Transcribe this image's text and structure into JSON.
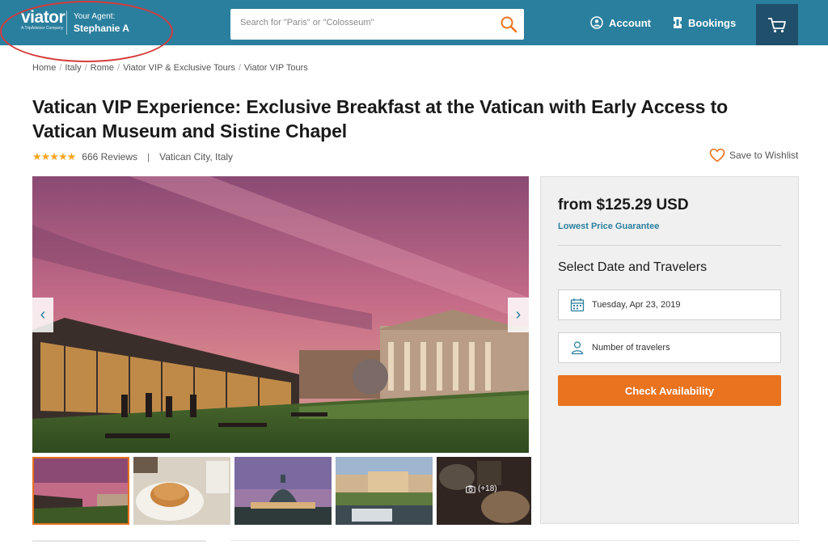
{
  "header": {
    "logo": {
      "word": "viator",
      "sub": "A TripAdvisor Company"
    },
    "agent": {
      "label": "Your Agent:",
      "name": "Stephanie A"
    },
    "search": {
      "placeholder": "Search for \"Paris\" or \"Colosseum\"",
      "value": ""
    },
    "nav": {
      "account": "Account",
      "bookings": "Bookings"
    },
    "colors": {
      "bar": "#2a7f9e",
      "cart_bg": "#1f4f6b",
      "annotation": "#d63a3a"
    }
  },
  "breadcrumb": [
    "Home",
    "Italy",
    "Rome",
    "Viator VIP & Exclusive Tours",
    "Viator VIP Tours"
  ],
  "product": {
    "title": "Vatican VIP Experience: Exclusive Breakfast at the Vatican with Early Access to Vatican Museum and Sistine Chapel",
    "stars": "★★★★★",
    "rating_value": 5,
    "reviews": "666 Reviews",
    "location": "Vatican City, Italy",
    "wishlist": "Save to Wishlist"
  },
  "gallery": {
    "thumbnails": [
      {
        "icon": "courtyard-sunset"
      },
      {
        "icon": "breakfast-plate"
      },
      {
        "icon": "st-peters-dome"
      },
      {
        "icon": "museum-courtyard"
      },
      {
        "icon": "breakfast-table",
        "more": "(+18)"
      }
    ],
    "active_index": 0
  },
  "booking": {
    "price": "from $125.29 USD",
    "guarantee": "Lowest Price Guarantee",
    "select_title": "Select Date and Travelers",
    "date": "Tuesday, Apr 23, 2019",
    "travelers_placeholder": "Number of travelers",
    "button": "Check Availability",
    "colors": {
      "accent": "#e9731f",
      "link": "#2a7f9e"
    }
  }
}
